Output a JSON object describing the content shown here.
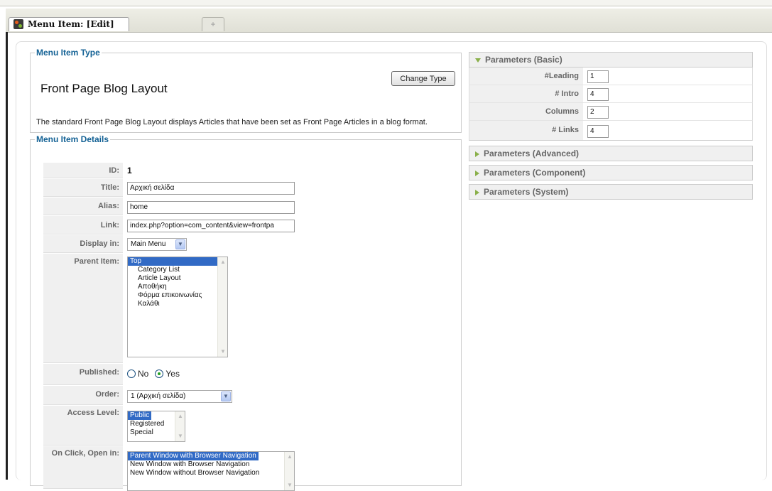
{
  "tab": {
    "title": "Menu Item: [Edit]",
    "new_tab": "+"
  },
  "type_box": {
    "legend": "Menu Item Type",
    "heading": "Front Page Blog Layout",
    "change_button": "Change Type",
    "description": "The standard Front Page Blog Layout displays Articles that have been set as Front Page Articles in a blog format."
  },
  "details": {
    "legend": "Menu Item Details",
    "id_label": "ID:",
    "id_value": "1",
    "title_label": "Title:",
    "title_value": "Αρχική σελίδα",
    "alias_label": "Alias:",
    "alias_value": "home",
    "link_label": "Link:",
    "link_value": "index.php?option=com_content&view=frontpa",
    "display_label": "Display in:",
    "display_value": "Main Menu",
    "parent_label": "Parent Item:",
    "parent_items": [
      "Top",
      "Category List",
      "Article Layout",
      "Αποθήκη",
      "Φόρμα επικοινωνίας",
      "Καλάθι"
    ],
    "published_label": "Published:",
    "published_no": "No",
    "published_yes": "Yes",
    "order_label": "Order:",
    "order_value": "1 (Αρχική σελίδα)",
    "access_label": "Access Level:",
    "access_items": [
      "Public",
      "Registered",
      "Special"
    ],
    "onclick_label": "On Click, Open in:",
    "onclick_items": [
      "Parent Window with Browser Navigation",
      "New Window with Browser Navigation",
      "New Window without Browser Navigation"
    ]
  },
  "params": {
    "basic_title": "Parameters (Basic)",
    "leading_label": "#Leading",
    "leading_value": "1",
    "intro_label": "# Intro",
    "intro_value": "4",
    "columns_label": "Columns",
    "columns_value": "2",
    "links_label": "# Links",
    "links_value": "4",
    "advanced_title": "Parameters (Advanced)",
    "component_title": "Parameters (Component)",
    "system_title": "Parameters (System)"
  },
  "colors": {
    "legend": "#146295",
    "accent_arrow": "#8ab04a",
    "selection": "#316ac5"
  }
}
